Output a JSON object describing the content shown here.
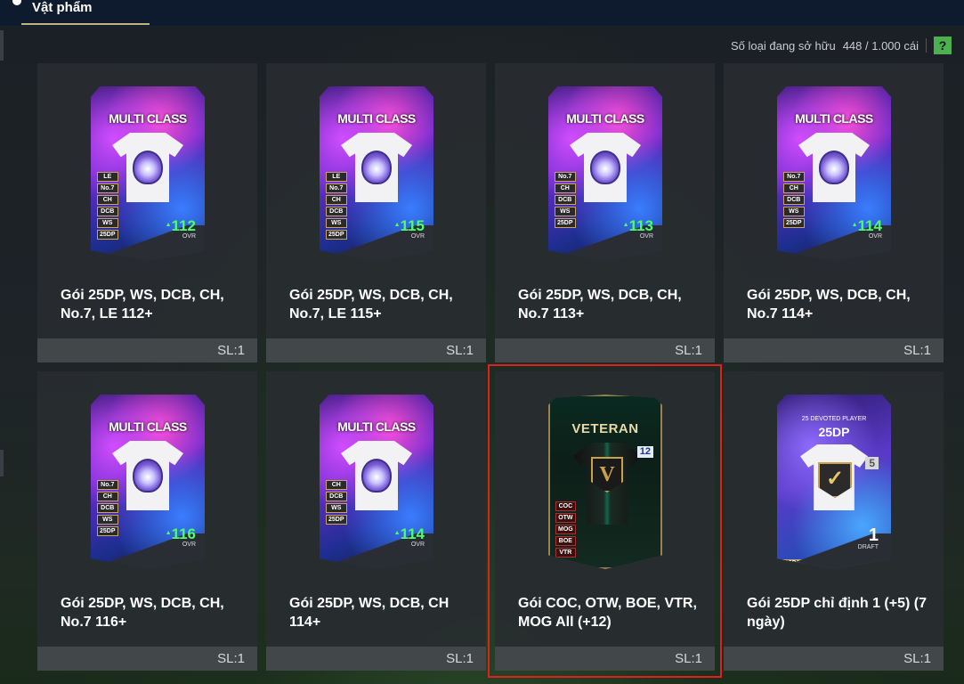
{
  "tab": {
    "label": "Vật phẩm"
  },
  "owned": {
    "label": "Số loại đang sở hữu",
    "value": "448 / 1.000 cái",
    "help": "?"
  },
  "items": [
    {
      "name": "Gói 25DP, WS, DCB, CH, No.7, LE 112+",
      "qty": "SL:1",
      "card": {
        "type": "multiclass",
        "title": "MULTI CLASS",
        "positions": [
          "LE",
          "No.7",
          "CH",
          "DCB",
          "WS",
          "25DP"
        ],
        "ovr": "112",
        "ovr_label": "OVR"
      }
    },
    {
      "name": "Gói 25DP, WS, DCB, CH, No.7, LE 115+",
      "qty": "SL:1",
      "card": {
        "type": "multiclass",
        "title": "MULTI CLASS",
        "positions": [
          "LE",
          "No.7",
          "CH",
          "DCB",
          "WS",
          "25DP"
        ],
        "ovr": "115",
        "ovr_label": "OVR"
      }
    },
    {
      "name": "Gói 25DP, WS, DCB, CH, No.7 113+",
      "qty": "SL:1",
      "card": {
        "type": "multiclass",
        "title": "MULTI CLASS",
        "positions": [
          "No.7",
          "CH",
          "DCB",
          "WS",
          "25DP"
        ],
        "ovr": "113",
        "ovr_label": "OVR"
      }
    },
    {
      "name": "Gói 25DP, WS, DCB, CH, No.7 114+",
      "qty": "SL:1",
      "card": {
        "type": "multiclass",
        "title": "MULTI CLASS",
        "positions": [
          "No.7",
          "CH",
          "DCB",
          "WS",
          "25DP"
        ],
        "ovr": "114",
        "ovr_label": "OVR"
      }
    },
    {
      "name": "Gói 25DP, WS, DCB, CH, No.7 116+",
      "qty": "SL:1",
      "card": {
        "type": "multiclass",
        "title": "MULTI CLASS",
        "positions": [
          "No.7",
          "CH",
          "DCB",
          "WS",
          "25DP"
        ],
        "ovr": "116",
        "ovr_label": "OVR"
      }
    },
    {
      "name": "Gói 25DP, WS, DCB, CH 114+",
      "qty": "SL:1",
      "card": {
        "type": "multiclass",
        "title": "MULTI CLASS",
        "positions": [
          "CH",
          "DCB",
          "WS",
          "25DP"
        ],
        "ovr": "114",
        "ovr_label": "OVR"
      }
    },
    {
      "name": "Gói COC, OTW, BOE, VTR, MOG All (+12)",
      "qty": "SL:1",
      "selected": true,
      "card": {
        "type": "veteran",
        "title": "VETERAN",
        "badge": "V",
        "level": "12",
        "positions": [
          "COC",
          "OTW",
          "MOG",
          "BOE",
          "VTR"
        ]
      }
    },
    {
      "name": "Gói 25DP chỉ định 1 (+5) (7 ngày)",
      "qty": "SL:1",
      "card": {
        "type": "draft",
        "subtitle": "25 DEVOTED PLAYER",
        "title": "25DP",
        "level": "5",
        "count": "1",
        "count_label": "DRAFT",
        "positions": [
          "25DP"
        ]
      }
    }
  ],
  "colors": {
    "selected_border": "#e0201f",
    "ovr_green": "#4cff6a",
    "help_green": "#4caf50",
    "topbar": "#0e1a2e"
  }
}
